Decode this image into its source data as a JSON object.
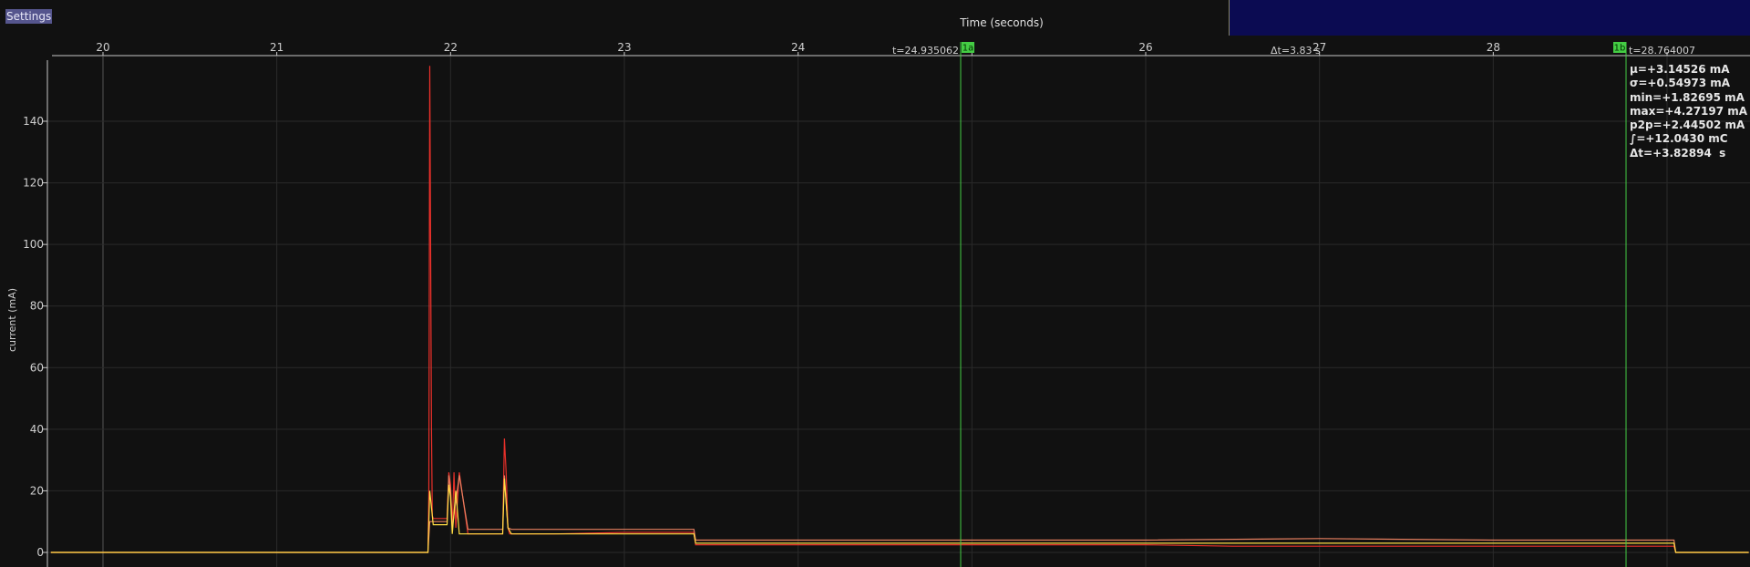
{
  "settings_button": {
    "label": "Settings"
  },
  "chart_data": {
    "type": "line",
    "title": "",
    "xlabel": "Time (seconds)",
    "ylabel": "current (mA)",
    "xlim": [
      19.7,
      29.47
    ],
    "ylim": [
      0,
      160
    ],
    "x_ticks": [
      20,
      21,
      22,
      23,
      24,
      25,
      26,
      27,
      28,
      29
    ],
    "x_tick_labels": [
      "20",
      "21",
      "22",
      "23",
      "24",
      "",
      "26",
      "27",
      "28",
      ""
    ],
    "y_ticks": [
      0,
      20,
      40,
      60,
      80,
      100,
      120,
      140
    ],
    "y_tick_labels": [
      "0",
      "20",
      "40",
      "60",
      "80",
      "100",
      "120",
      "140"
    ],
    "grid": true,
    "legend": "none",
    "series": [
      {
        "color": "#e8302a",
        "x": [
          19.7,
          21.87,
          21.875,
          21.88,
          21.89,
          21.895,
          21.9,
          21.91,
          21.98,
          21.99,
          22.0,
          22.01,
          22.02,
          22.03,
          22.05,
          22.1,
          22.2,
          22.3,
          22.31,
          22.32,
          22.33,
          22.34,
          22.4,
          22.6,
          23.0,
          23.4,
          23.41,
          23.6,
          24.0,
          25.0,
          26.0,
          26.5,
          27.0,
          28.0,
          28.8,
          29.0,
          29.04,
          29.05,
          29.47
        ],
        "y": [
          0,
          0,
          20,
          158,
          40,
          12,
          11,
          11,
          11,
          26,
          22,
          8,
          26,
          8,
          26,
          6,
          6,
          6,
          37,
          26,
          8,
          6,
          6,
          6,
          6.5,
          6.5,
          2.5,
          2.5,
          2.5,
          2.5,
          2.5,
          2,
          2,
          2,
          2,
          2,
          2,
          0,
          0
        ]
      },
      {
        "color": "#e88060",
        "x": [
          19.7,
          21.87,
          21.88,
          21.9,
          21.98,
          21.99,
          22.0,
          22.01,
          22.05,
          22.1,
          22.3,
          22.31,
          22.33,
          22.35,
          23.0,
          23.4,
          23.41,
          24.0,
          25.0,
          26.0,
          27.0,
          28.0,
          29.0,
          29.04,
          29.05,
          29.47
        ],
        "y": [
          0,
          0,
          10,
          10,
          10,
          25,
          20,
          8,
          25,
          7.5,
          7.5,
          25,
          8,
          7.5,
          7.5,
          7.5,
          4,
          4,
          4,
          4,
          4.5,
          4,
          4,
          4,
          0,
          0
        ]
      },
      {
        "color": "#ffdd44",
        "x": [
          19.7,
          21.87,
          21.88,
          21.9,
          21.98,
          21.99,
          22.0,
          22.01,
          22.03,
          22.05,
          22.1,
          22.3,
          22.31,
          22.33,
          22.35,
          23.0,
          23.4,
          23.41,
          24.0,
          25.0,
          26.0,
          27.0,
          28.0,
          29.0,
          29.04,
          29.05,
          29.47
        ],
        "y": [
          0,
          0,
          20,
          9,
          9,
          22,
          18,
          6,
          20,
          6,
          6,
          6,
          24,
          8,
          6,
          6,
          6,
          3,
          3,
          3,
          3,
          3,
          3,
          3,
          3,
          0,
          0
        ]
      }
    ],
    "markers": [
      {
        "id": "1a",
        "x": 24.935062,
        "label": "1a",
        "readout": "t=24.935062",
        "color": "#44cc44"
      },
      {
        "id": "1b",
        "x": 28.764007,
        "label": "1b",
        "readout": "t=28.764007",
        "color": "#44cc44"
      }
    ],
    "delta_label": "Δt=3.83 s",
    "statistics": [
      "μ=+3.14526 mA",
      "σ=+0.54973 mA",
      "min=+1.82695 mA",
      "max=+4.27197 mA",
      "p2p=+2.44502 mA",
      "∫=+12.0430 mC",
      "Δt=+3.82894  s"
    ]
  },
  "colors": {
    "background": "#111111",
    "grid": "#2a2a2a",
    "axis": "#c8c8c8",
    "text": "#d0d0d0",
    "overview_panel": "#0b0b52",
    "settings_button_bg": "#55558d",
    "marker": "#44cc44"
  }
}
